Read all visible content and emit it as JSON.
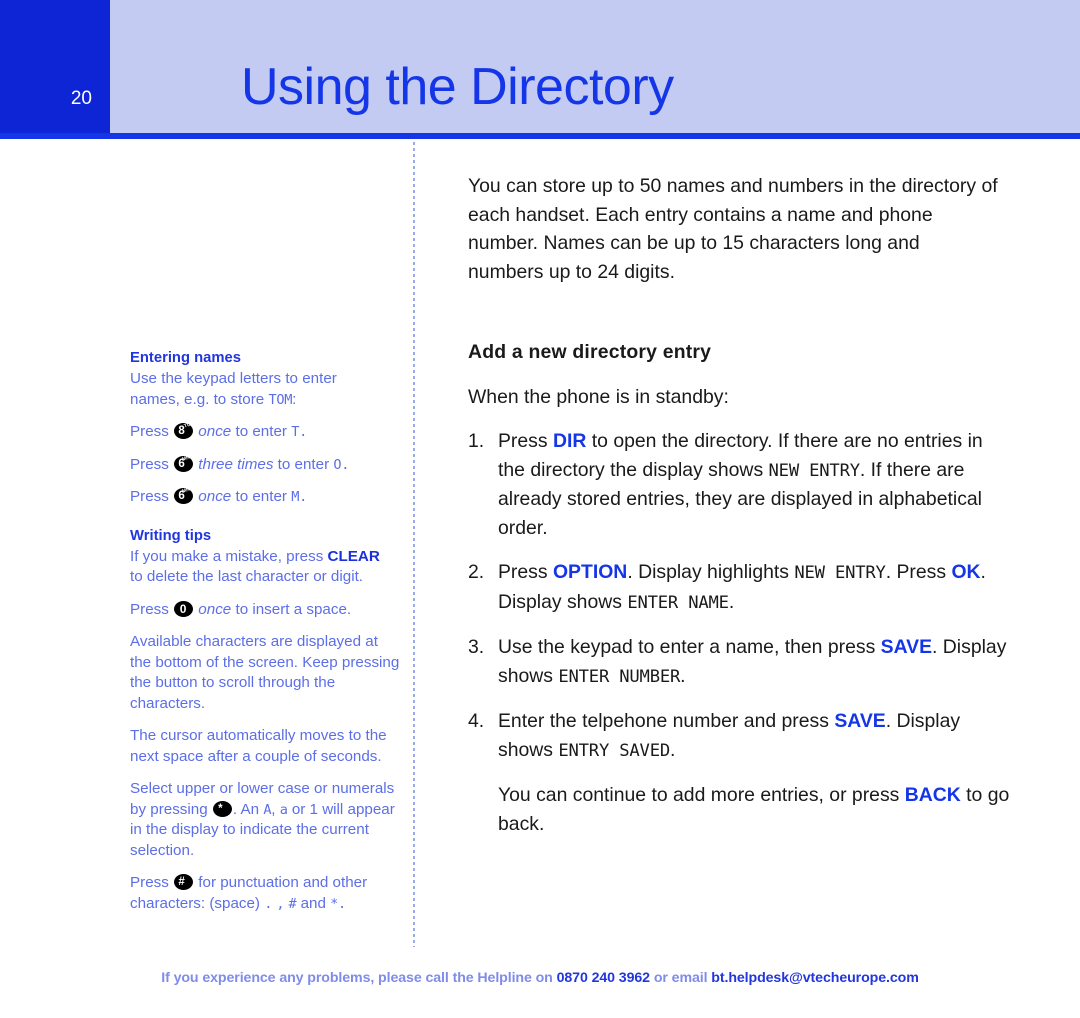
{
  "header": {
    "page_number": "20",
    "title": "Using the Directory",
    "page_block_color": "#0d25d4",
    "title_block_color": "#c3cbf2",
    "title_color": "#1536e8"
  },
  "sidebar": {
    "sections": [
      {
        "heading": "Entering names",
        "lines": [
          "Use the keypad letters to enter",
          "names, e.g. to store TOM:"
        ],
        "store_word": "TOM",
        "presses": [
          {
            "press": "Press",
            "key": "8",
            "key_sup": "TUV",
            "times": "once",
            "tail": "to enter",
            "char": "T."
          },
          {
            "press": "Press",
            "key": "6",
            "key_sup": "MNO",
            "times": "three times",
            "tail": "to enter",
            "char": "O."
          },
          {
            "press": "Press",
            "key": "6",
            "key_sup": "MNO",
            "times": "once",
            "tail": "to enter",
            "char": "M."
          }
        ]
      },
      {
        "heading": "Writing tips",
        "clear_line_a": "If you make a mistake, press",
        "clear_label": "CLEAR",
        "clear_line_b": "to delete the last character or digit.",
        "space_press": "Press",
        "space_key": "0",
        "space_times": "once",
        "space_tail": "to insert a space.",
        "paragraphs": [
          "Available characters are displayed at the bottom of the screen. Keep pressing the button to scroll through the characters.",
          "The cursor automatically moves to the next space after a couple of seconds."
        ],
        "case_line_a": "Select upper or lower case or",
        "case_line_b": "numerals by pressing",
        "case_key": "*",
        "case_line_c": ". An",
        "case_sample_a": "A",
        "case_sample_b": "a",
        "case_line_d": "or 1 will appear in the display to indicate the current selection.",
        "punct_press": "Press",
        "punct_key": "#",
        "punct_tail": "for punctuation and other",
        "punct_line_b": "characters: (space)",
        "punct_chars": [
          ".",
          ",",
          "#"
        ],
        "punct_and": "and",
        "punct_last": "*."
      }
    ]
  },
  "main": {
    "intro": "You can store up to 50 names and numbers in the directory of each handset. Each entry contains a name and phone number. Names can be up to 15 characters long and numbers up to 24 digits.",
    "heading": "Add a new directory entry",
    "subheading": "When the phone is in standby:",
    "steps": [
      {
        "number": "1.",
        "pre": "Press",
        "key": "DIR",
        "mid": "to open the directory. If there are no entries in the directory the display shows",
        "lcd": "NEW  ENTRY",
        "post": ". If there are already stored entries, they are displayed in alphabetical order."
      },
      {
        "number": "2.",
        "pre": "Press",
        "key": "OPTION",
        "mid": ". Display highlights",
        "lcd": "NEW ENTRY",
        "mid2": ". Press",
        "key2": "OK",
        "post": ". Display shows",
        "lcd2": "ENTER NAME",
        "end": "."
      },
      {
        "number": "3.",
        "pre": "Use the keypad to enter a name, then press",
        "key": "SAVE",
        "post": ". Display shows",
        "lcd": "ENTER NUMBER",
        "end": "."
      },
      {
        "number": "4.",
        "pre": "Enter the telpehone number and press",
        "key": "SAVE",
        "post": ". Display shows",
        "lcd": "ENTRY SAVED",
        "end": "."
      }
    ],
    "closing_pre": "You can continue to add more entries, or press",
    "closing_key": "BACK",
    "closing_post": "to go back."
  },
  "footer": {
    "lead": "If you experience any problems, please call the Helpline on",
    "phone": "0870 240 3962",
    "mid": "or email",
    "email": "bt.helpdesk@vtecheurope.com",
    "color": "#7f8ce9",
    "highlight_color": "#2236dd"
  }
}
